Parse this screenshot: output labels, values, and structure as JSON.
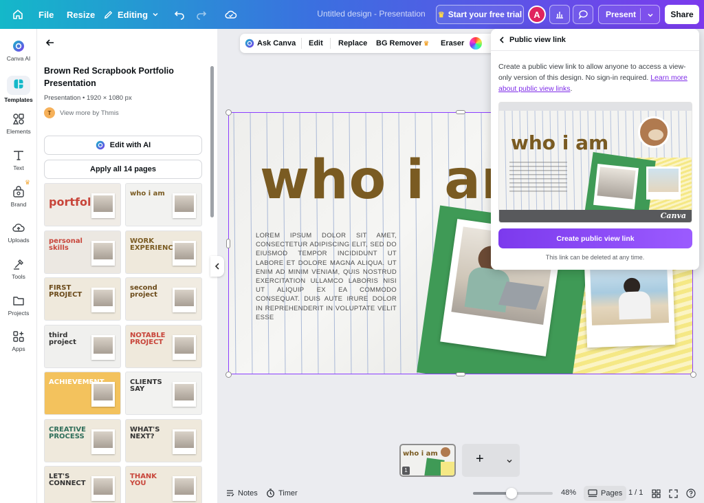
{
  "topbar": {
    "file_label": "File",
    "resize_label": "Resize",
    "editing_label": "Editing",
    "title": "Untitled design - Presentation",
    "trial_label": "Start your free trial",
    "avatar_initial": "A",
    "present_label": "Present",
    "share_label": "Share"
  },
  "rail": {
    "items": [
      {
        "label": "Canva AI",
        "icon": "canva-ai-icon"
      },
      {
        "label": "Templates",
        "icon": "templates-icon"
      },
      {
        "label": "Elements",
        "icon": "elements-icon"
      },
      {
        "label": "Text",
        "icon": "text-icon"
      },
      {
        "label": "Brand",
        "icon": "brand-icon"
      },
      {
        "label": "Uploads",
        "icon": "uploads-icon"
      },
      {
        "label": "Tools",
        "icon": "tools-icon"
      },
      {
        "label": "Projects",
        "icon": "projects-icon"
      },
      {
        "label": "Apps",
        "icon": "apps-icon"
      }
    ]
  },
  "panel": {
    "title": "Brown Red Scrapbook Portfolio Presentation",
    "subtitle": "Presentation • 1920 × 1080 px",
    "author_initial": "T",
    "author_text": "View more by Thmis",
    "edit_ai_label": "Edit with AI",
    "apply_label": "Apply all 14 pages",
    "thumbnails": [
      {
        "label": "portfolio",
        "bg": "#f0ece6",
        "color": "#c8453a"
      },
      {
        "label": "who i am",
        "bg": "#f2f2f0",
        "color": "#7a5b22"
      },
      {
        "label": "personal skills",
        "bg": "#ece8e2",
        "color": "#c8453a"
      },
      {
        "label": "WORK EXPERIENCE",
        "bg": "#efe9dc",
        "color": "#7a5b22"
      },
      {
        "label": "FIRST PROJECT",
        "bg": "#efe9dc",
        "color": "#6b4a1a"
      },
      {
        "label": "second project",
        "bg": "#f1ece2",
        "color": "#6b4a1a"
      },
      {
        "label": "third project",
        "bg": "#f0f0ee",
        "color": "#333333"
      },
      {
        "label": "NOTABLE PROJECT",
        "bg": "#efe9dc",
        "color": "#c8453a"
      },
      {
        "label": "ACHIEVEMENT",
        "bg": "#f3c25d",
        "color": "#ffffff"
      },
      {
        "label": "CLIENTS SAY",
        "bg": "#f2f2f0",
        "color": "#333333"
      },
      {
        "label": "CREATIVE PROCESS",
        "bg": "#efe9dc",
        "color": "#2f6e5a"
      },
      {
        "label": "WHAT'S NEXT?",
        "bg": "#efe9dc",
        "color": "#333333"
      },
      {
        "label": "LET'S CONNECT",
        "bg": "#efe9dc",
        "color": "#333333"
      },
      {
        "label": "THANK YOU",
        "bg": "#efe9dc",
        "color": "#c8453a"
      }
    ]
  },
  "toolbar": {
    "ask_canva": "Ask Canva",
    "edit": "Edit",
    "replace": "Replace",
    "bg_remover": "BG Remover",
    "eraser": "Eraser"
  },
  "slide": {
    "headline": "who i am",
    "body": "Lorem ipsum dolor sit amet, consectetur adipiscing elit, sed do eiusmod tempor incididunt ut labore et dolore magna aliqua. Ut enim ad minim veniam, quis nostrud exercitation ullamco laboris nisi ut aliquip ex ea commodo consequat. Duis aute irure dolor in reprehenderit in voluptate velit esse"
  },
  "popover": {
    "title": "Public view link",
    "description": "Create a public view link to allow anyone to access a view-only version of this design. No sign-in required.",
    "learn_more": "Learn more about public view links",
    "preview_brand": "Canva",
    "cta_label": "Create public view link",
    "note": "This link can be deleted at any time."
  },
  "pages_strip": {
    "page_number": "1",
    "add_symbol": "+"
  },
  "bottombar": {
    "notes_label": "Notes",
    "timer_label": "Timer",
    "zoom_value": 48,
    "zoom_label": "48%",
    "pages_label": "Pages",
    "page_count": "1 / 1"
  },
  "colors": {
    "accent": "#8b3dff",
    "headline": "#7a5b22",
    "green_paper": "#3f9a56",
    "yellow_paper": "#f3e27a"
  }
}
